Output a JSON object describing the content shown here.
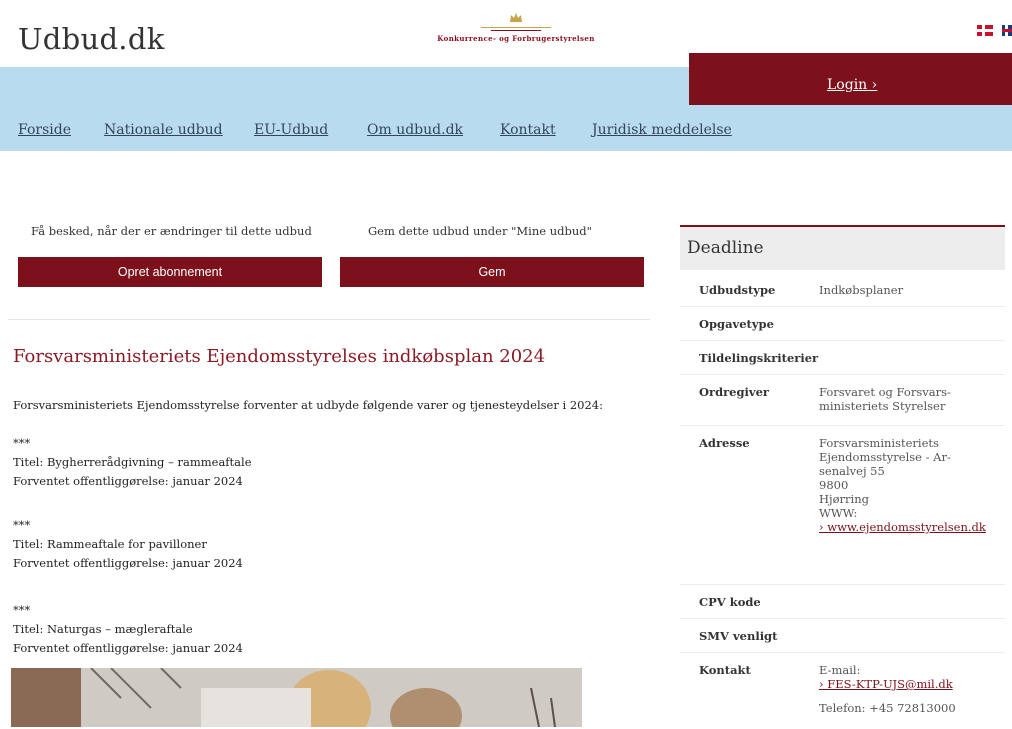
{
  "header": {
    "site_title": "Udbud.dk",
    "agency_name": "Konkurrence- og Forbrugerstyrelsen",
    "languages": [
      "Dansk",
      "English"
    ]
  },
  "login": {
    "label": "Login ›"
  },
  "nav": {
    "items": [
      "Forside",
      "Nationale udbud",
      "EU-Udbud",
      "Om udbud.dk",
      "Kontakt",
      "Juridisk meddelelse"
    ]
  },
  "actions": {
    "subscribe_prompt": "Få besked, når der er ændringer til dette udbud",
    "subscribe_label": "Opret abonnement",
    "save_prompt": "Gem dette udbud under \"Mine udbud\"",
    "save_label": "Gem"
  },
  "content": {
    "title": "Forsvarsministeriets Ejendomsstyrelses indkøbsplan 2024",
    "intro": "Forsvarsministeriets Ejendomsstyrelse forventer at udbyde følgende varer og tjenesteydelser i 2024:",
    "items": [
      {
        "marker": "***",
        "title": "Titel: Bygherrerådgivning – rammeaftale",
        "date": "Forventet offentliggørelse: januar 2024"
      },
      {
        "marker": "***",
        "title": "Titel: Rammeaftale for pavilloner",
        "date": "Forventet offentliggørelse: januar 2024"
      },
      {
        "marker": "***",
        "title": "Titel: Naturgas – mægleraftale",
        "date": "Forventet offentliggørelse: januar 2024"
      }
    ]
  },
  "sidebar": {
    "heading": "Deadline",
    "udbudstype_label": "Udbudstype",
    "udbudstype_value": "Indkøbsplaner",
    "opgavetype_label": "Opgavetype",
    "tildeling_label": "Tildelingskriterier",
    "ordregiver_label": "Ordregiver",
    "ordregiver_value": "Forsvaret og Forsvars-ministeriets Styrelser",
    "adresse_label": "Adresse",
    "adresse_line1": "Forsvarsministeriets Ejendomsstyrelse - Ar-senalvej 55",
    "adresse_postcode": "9800",
    "adresse_city": "Hjørring",
    "adresse_www_label": "WWW:",
    "adresse_www_link": "› www.ejendomsstyrelsen.dk",
    "cpv_label": "CPV kode",
    "smv_label": "SMV venligt",
    "kontakt_label": "Kontakt",
    "email_label": "E-mail:",
    "email_link": "› FES-KTP-UJS@mil.dk",
    "phone": "Telefon: +45 72813000"
  }
}
